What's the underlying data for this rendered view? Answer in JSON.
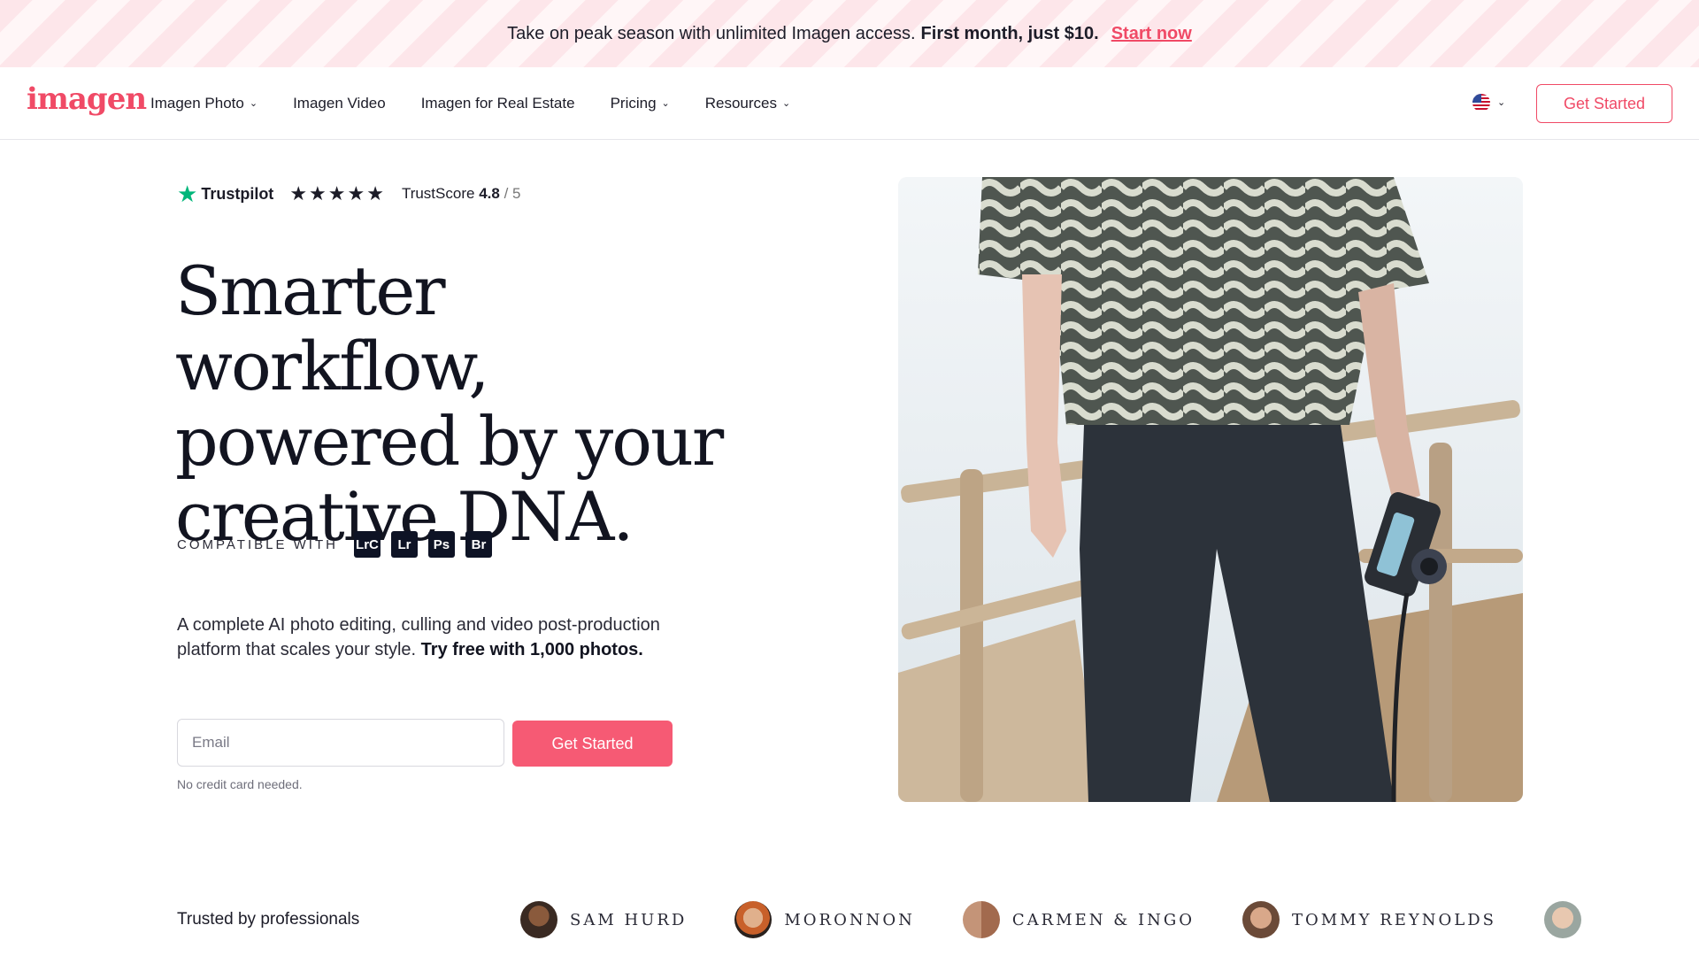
{
  "promo": {
    "text": "Take on peak season with unlimited Imagen access.",
    "highlight": "First month, just $10.",
    "link": "Start now"
  },
  "nav": {
    "logo": "imagen",
    "items": [
      {
        "label": "Imagen Photo",
        "has_dropdown": true
      },
      {
        "label": "Imagen Video",
        "has_dropdown": false
      },
      {
        "label": "Imagen for Real Estate",
        "has_dropdown": false
      },
      {
        "label": "Pricing",
        "has_dropdown": true
      },
      {
        "label": "Resources",
        "has_dropdown": true
      }
    ],
    "language_icon": "us-flag-icon",
    "cta": "Get Started"
  },
  "hero": {
    "trustpilot": {
      "brand": "Trustpilot",
      "stars": "★★★★★",
      "score_label": "TrustScore",
      "score": "4.8",
      "max": "/ 5"
    },
    "headline_lines": [
      "Smarter workflow,",
      "powered by your",
      "creative DNA."
    ],
    "compatible_label": "COMPATIBLE WITH",
    "apps": [
      "LrC",
      "Lr",
      "Ps",
      "Br"
    ],
    "description": "A complete AI photo editing, culling and video post-production platform that scales your style.",
    "description_bold": "Try free with 1,000 photos.",
    "email_placeholder": "Email",
    "email_value": "",
    "cta": "Get Started",
    "note": "No credit card needed."
  },
  "trusted": {
    "label": "Trusted by professionals",
    "pros": [
      "SAM HURD",
      "MORONNON",
      "CARMEN & INGO",
      "TOMMY REYNOLDS"
    ]
  },
  "colors": {
    "brand": "#f04a66",
    "cta_fill": "#f65a74",
    "dark_text": "#121420",
    "trustpilot_green": "#00b67a"
  }
}
